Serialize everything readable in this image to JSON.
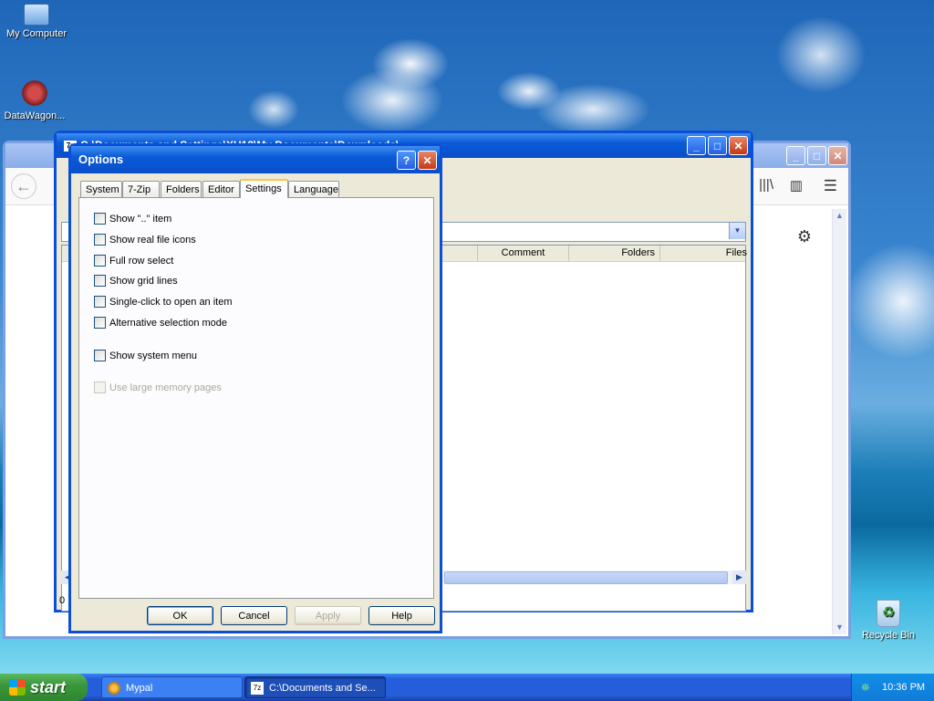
{
  "desktop": {
    "icons": [
      {
        "label": "My Computer"
      },
      {
        "label": "DataWagon..."
      },
      {
        "label": "Recycle Bin"
      }
    ]
  },
  "browser": {
    "title": "",
    "back_icon": "back-arrow-icon",
    "toolbar_icons": [
      "library-icon",
      "sidebar-icon",
      "menu-icon"
    ],
    "gear_icon": "gear-icon"
  },
  "filemanager": {
    "title": "C:\\Documents and Settings\\XU13\\My Documents\\Downloads\\",
    "columns": [
      "Comment",
      "Folders",
      "Files"
    ],
    "status": "0"
  },
  "options": {
    "title": "Options",
    "help_glyph": "?",
    "close_glyph": "✕",
    "tabs": [
      "System",
      "7-Zip",
      "Folders",
      "Editor",
      "Settings",
      "Language"
    ],
    "active_tab": "Settings",
    "checkboxes": [
      {
        "label": "Show \"..\" item",
        "checked": false,
        "enabled": true
      },
      {
        "label": "Show real file icons",
        "checked": false,
        "enabled": true
      },
      {
        "label": "Full row select",
        "checked": false,
        "enabled": true
      },
      {
        "label": "Show grid lines",
        "checked": false,
        "enabled": true
      },
      {
        "label": "Single-click to open an item",
        "checked": false,
        "enabled": true
      },
      {
        "label": "Alternative selection mode",
        "checked": false,
        "enabled": true
      },
      {
        "label": "Show system menu",
        "checked": false,
        "enabled": true
      },
      {
        "label": "Use large memory pages",
        "checked": false,
        "enabled": false
      }
    ],
    "buttons": {
      "ok": "OK",
      "cancel": "Cancel",
      "apply": "Apply",
      "help": "Help"
    }
  },
  "taskbar": {
    "start_label": "start",
    "tasks": [
      {
        "label": "Mypal",
        "active": false
      },
      {
        "label": "C:\\Documents and Se...",
        "active": true
      }
    ],
    "clock": "10:36 PM"
  }
}
